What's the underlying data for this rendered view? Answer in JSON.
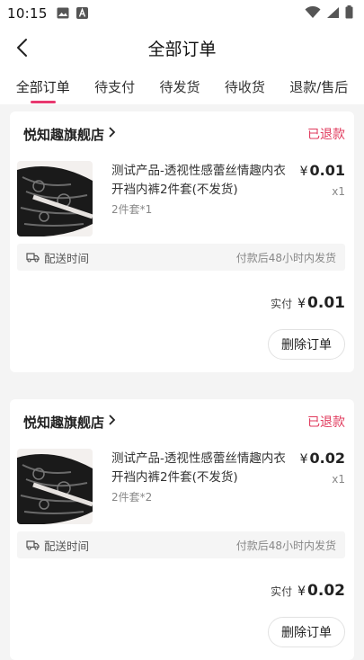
{
  "status_bar": {
    "time": "10:15",
    "left_icons": [
      "image-icon",
      "font-icon"
    ],
    "right_icons": [
      "wifi-icon",
      "signal-icon",
      "battery-icon"
    ]
  },
  "header": {
    "title": "全部订单"
  },
  "tabs": [
    {
      "label": "全部订单",
      "active": true
    },
    {
      "label": "待支付",
      "active": false
    },
    {
      "label": "待发货",
      "active": false
    },
    {
      "label": "待收货",
      "active": false
    },
    {
      "label": "退款/售后",
      "active": false
    }
  ],
  "orders": [
    {
      "store": "悦知趣旗舰店",
      "status": "已退款",
      "product_name": "测试产品-透视性感蕾丝情趣内衣开裆内裤2件套(不发货)",
      "spec": "2件套*1",
      "currency": "¥",
      "price": "0.01",
      "qty": "x1",
      "shipping_label": "配送时间",
      "shipping_note": "付款后48小时内发货",
      "paid_label": "实付",
      "paid_amount": "0.01",
      "delete_label": "删除订单"
    },
    {
      "store": "悦知趣旗舰店",
      "status": "已退款",
      "product_name": "测试产品-透视性感蕾丝情趣内衣开裆内裤2件套(不发货)",
      "spec": "2件套*2",
      "currency": "¥",
      "price": "0.02",
      "qty": "x1",
      "shipping_label": "配送时间",
      "shipping_note": "付款后48小时内发货",
      "paid_label": "实付",
      "paid_amount": "0.02",
      "delete_label": "删除订单"
    }
  ],
  "colors": {
    "accent": "#e8386f",
    "status_red": "#e03a5c",
    "background": "#f4f4f4"
  }
}
